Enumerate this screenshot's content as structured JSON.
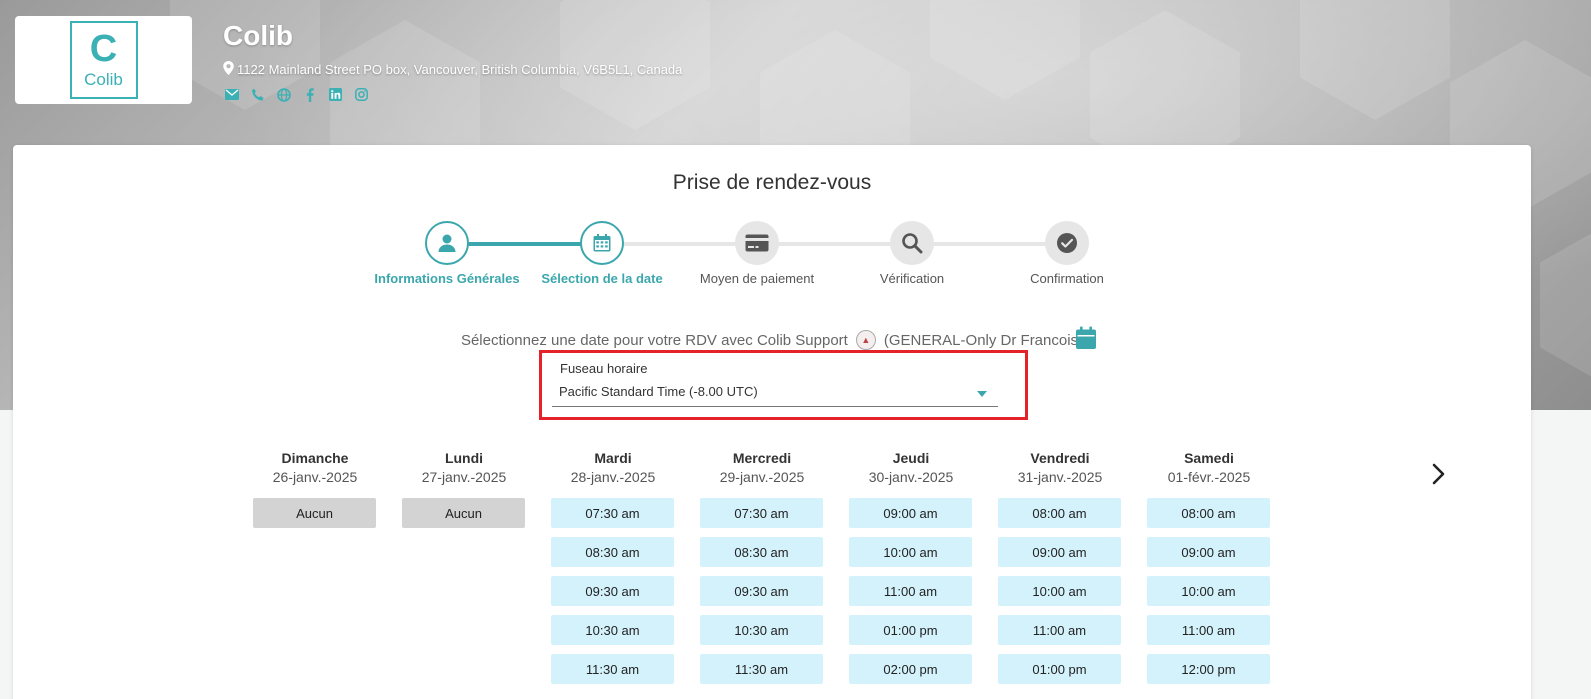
{
  "header": {
    "logo_text": "Colib",
    "logo_letter": "C",
    "company_name": "Colib",
    "address": "1122 Mainland Street PO box, Vancouver, British Columbia, V6B5L1, Canada",
    "social_icons": [
      "mail-icon",
      "phone-icon",
      "globe-icon",
      "facebook-icon",
      "linkedin-icon",
      "instagram-icon"
    ],
    "accent_color": "#3ba7ad"
  },
  "main": {
    "title": "Prise de rendez-vous",
    "steps": [
      {
        "label": "Informations Générales",
        "icon": "user-icon",
        "active": true
      },
      {
        "label": "Sélection de la date",
        "icon": "calendar-icon",
        "active": true
      },
      {
        "label": "Moyen de paiement",
        "icon": "credit-card-icon",
        "active": false
      },
      {
        "label": "Vérification",
        "icon": "search-icon",
        "active": false
      },
      {
        "label": "Confirmation",
        "icon": "check-circle-icon",
        "active": false
      }
    ],
    "select_prompt": "Sélectionnez une date pour votre RDV avec Colib Support",
    "service": "(GENERAL-Only Dr Francois)",
    "timezone": {
      "label": "Fuseau horaire",
      "value": "Pacific Standard Time (-8.00 UTC)"
    },
    "days": [
      {
        "name": "Dimanche",
        "date": "26-janv.-2025",
        "slots": [
          "Aucun"
        ],
        "empty": true
      },
      {
        "name": "Lundi",
        "date": "27-janv.-2025",
        "slots": [
          "Aucun"
        ],
        "empty": true
      },
      {
        "name": "Mardi",
        "date": "28-janv.-2025",
        "slots": [
          "07:30 am",
          "08:30 am",
          "09:30 am",
          "10:30 am",
          "11:30 am"
        ],
        "empty": false
      },
      {
        "name": "Mercredi",
        "date": "29-janv.-2025",
        "slots": [
          "07:30 am",
          "08:30 am",
          "09:30 am",
          "10:30 am",
          "11:30 am"
        ],
        "empty": false
      },
      {
        "name": "Jeudi",
        "date": "30-janv.-2025",
        "slots": [
          "09:00 am",
          "10:00 am",
          "11:00 am",
          "01:00 pm",
          "02:00 pm"
        ],
        "empty": false
      },
      {
        "name": "Vendredi",
        "date": "31-janv.-2025",
        "slots": [
          "08:00 am",
          "09:00 am",
          "10:00 am",
          "11:00 am",
          "01:00 pm"
        ],
        "empty": false
      },
      {
        "name": "Samedi",
        "date": "01-févr.-2025",
        "slots": [
          "08:00 am",
          "09:00 am",
          "10:00 am",
          "11:00 am",
          "12:00 pm"
        ],
        "empty": false
      }
    ]
  }
}
